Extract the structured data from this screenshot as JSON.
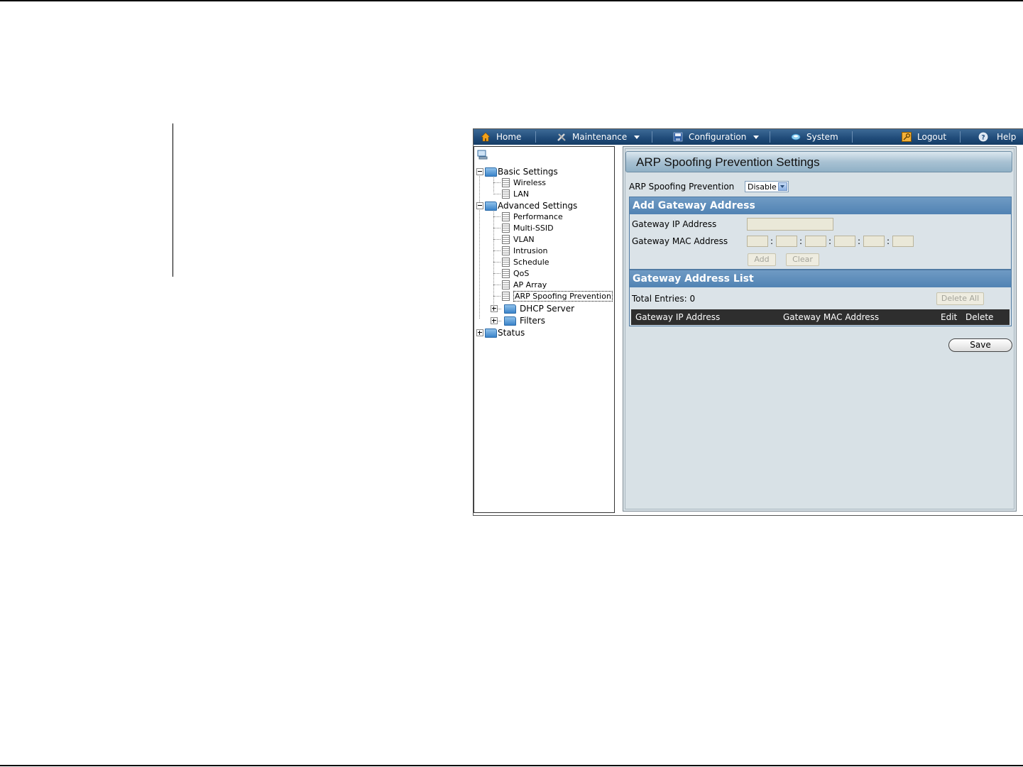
{
  "menu": {
    "home": "Home",
    "maintenance": "Maintenance",
    "configuration": "Configuration",
    "system": "System",
    "logout": "Logout",
    "help": "Help"
  },
  "tree": {
    "basic_settings": "Basic Settings",
    "wireless": "Wireless",
    "lan": "LAN",
    "advanced_settings": "Advanced Settings",
    "performance": "Performance",
    "multi_ssid": "Multi-SSID",
    "vlan": "VLAN",
    "intrusion": "Intrusion",
    "schedule": "Schedule",
    "qos": "QoS",
    "ap_array": "AP Array",
    "arp_spoofing_prevention": "ARP Spoofing Prevention",
    "dhcp_server": "DHCP Server",
    "filters": "Filters",
    "status": "Status"
  },
  "page": {
    "title": "ARP Spoofing Prevention Settings",
    "arp_label": "ARP Spoofing Prevention",
    "arp_value": "Disable",
    "add_section_title": "Add Gateway Address",
    "gateway_ip_label": "Gateway IP Address",
    "gateway_mac_label": "Gateway MAC Address",
    "mac_separator": ":",
    "add_button": "Add",
    "clear_button": "Clear",
    "list_section_title": "Gateway Address List",
    "total_entries": "Total Entries: 0",
    "delete_all_button": "Delete All",
    "col_ip": "Gateway IP Address",
    "col_mac": "Gateway MAC Address",
    "col_edit": "Edit",
    "col_delete": "Delete",
    "save_button": "Save"
  },
  "colors": {
    "menubar": "#1f4a78",
    "section_header": "#5183b3",
    "content_bg": "#d8e1e6"
  }
}
